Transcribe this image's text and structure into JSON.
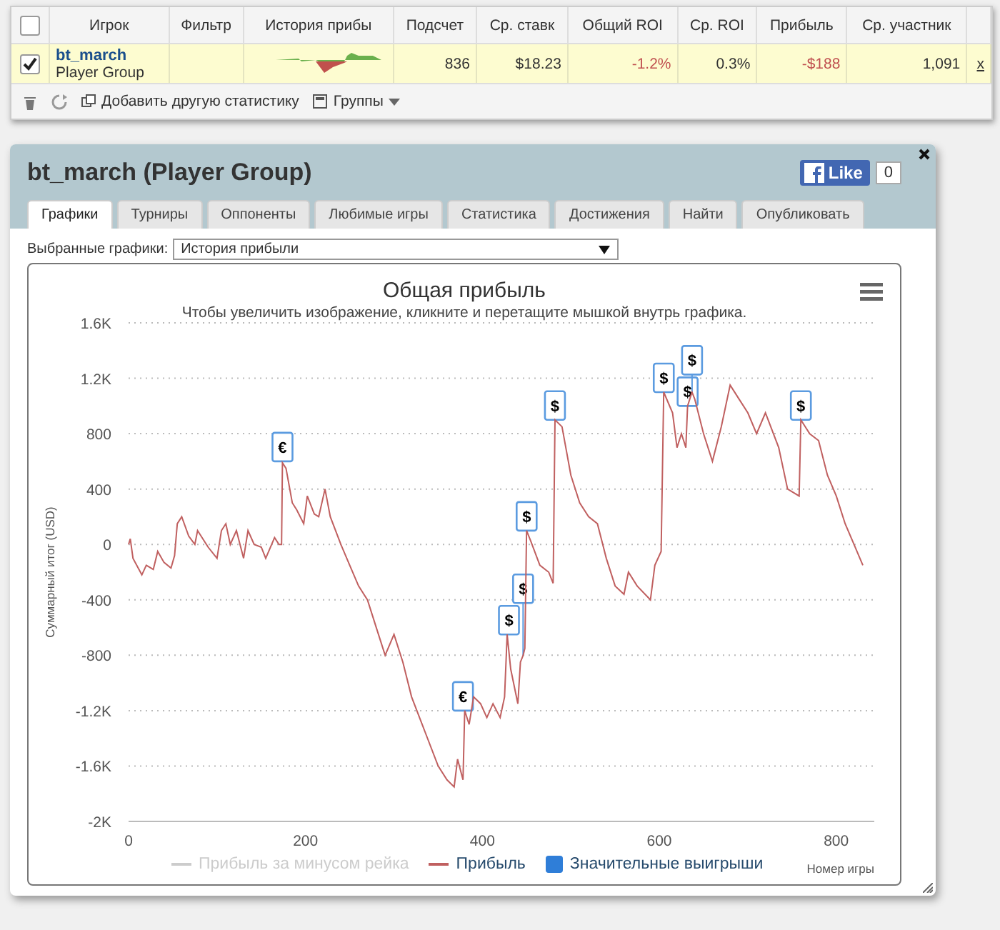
{
  "stats_table": {
    "columns": [
      "Игрок",
      "Фильтр",
      "История прибы",
      "Подсчет",
      "Ср. ставк",
      "Общий ROI",
      "Ср. ROI",
      "Прибыль",
      "Ср. участник"
    ],
    "select_all_checked": false,
    "rows": [
      {
        "checked": true,
        "cells": [
          {
            "kind": "player",
            "text": "bt_march",
            "sub": "Player Group"
          },
          {
            "kind": "text",
            "text": ""
          },
          {
            "kind": "sparkline"
          },
          {
            "kind": "text",
            "text": "836",
            "negative": false
          },
          {
            "kind": "text",
            "text": "$18.23",
            "negative": false
          },
          {
            "kind": "text",
            "text": "-1.2%",
            "negative": true
          },
          {
            "kind": "text",
            "text": "0.3%",
            "negative": false
          },
          {
            "kind": "text",
            "text": "-$188",
            "negative": true
          },
          {
            "kind": "text",
            "text": "1,091",
            "negative": false
          }
        ],
        "remove": "x"
      }
    ],
    "toolbar": {
      "add_stat": "Добавить другую статистику",
      "groups": "Группы"
    }
  },
  "dialog": {
    "title": "bt_march (Player Group)",
    "like": {
      "label": "Like",
      "count": "0"
    },
    "tabs": [
      {
        "label": "Графики",
        "selected": true
      },
      {
        "label": "Турниры",
        "selected": false
      },
      {
        "label": "Оппоненты",
        "selected": false
      },
      {
        "label": "Любимые игры",
        "selected": false
      },
      {
        "label": "Статистика",
        "selected": false
      },
      {
        "label": "Достижения",
        "selected": false
      },
      {
        "label": "Найти",
        "selected": false
      },
      {
        "label": "Опубликовать",
        "selected": false
      }
    ],
    "chart_select": {
      "label": "Выбранные графики:",
      "value": "История прибыли"
    },
    "chart": {
      "chart_data": {
        "type": "line",
        "title": "Общая прибыль",
        "subtitle": "Чтобы увеличить изображение, кликните и перетащите мышкой внутрь графика.",
        "xlabel": "Номер игры",
        "ylabel": "Суммарный итог (USD)",
        "grid": true,
        "xlim": [
          0,
          843
        ],
        "ylim": [
          -2000,
          1600
        ],
        "xticks": [
          0,
          200,
          400,
          600,
          800
        ],
        "yticks": [
          {
            "value": -2000,
            "label": "-2K"
          },
          {
            "value": -1600,
            "label": "-1.6K"
          },
          {
            "value": -1200,
            "label": "-1.2K"
          },
          {
            "value": -800,
            "label": "-800"
          },
          {
            "value": -400,
            "label": "-400"
          },
          {
            "value": 0,
            "label": "0"
          },
          {
            "value": 400,
            "label": "400"
          },
          {
            "value": 800,
            "label": "800"
          },
          {
            "value": 1200,
            "label": "1.2K"
          },
          {
            "value": 1600,
            "label": "1.6K"
          }
        ],
        "x": [
          0,
          2,
          5,
          15,
          20,
          28,
          33,
          40,
          48,
          52,
          55,
          60,
          68,
          75,
          78,
          90,
          100,
          105,
          110,
          115,
          122,
          130,
          135,
          142,
          150,
          155,
          165,
          170,
          173,
          174,
          178,
          185,
          190,
          198,
          202,
          210,
          215,
          222,
          228,
          240,
          250,
          260,
          270,
          280,
          290,
          300,
          310,
          320,
          335,
          350,
          360,
          368,
          372,
          378,
          380,
          385,
          390,
          398,
          405,
          412,
          420,
          425,
          428,
          432,
          440,
          443,
          446,
          448,
          450,
          455,
          465,
          475,
          480,
          482,
          490,
          500,
          510,
          520,
          530,
          540,
          550,
          560,
          565,
          575,
          590,
          595,
          602,
          605,
          615,
          620,
          625,
          630,
          632,
          637,
          640,
          650,
          660,
          670,
          680,
          690,
          700,
          710,
          720,
          735,
          745,
          758,
          760,
          770,
          780,
          790,
          800,
          810,
          820,
          830
        ],
        "series": [
          {
            "name": "Прибыль",
            "color": "#c06060",
            "values": [
              0,
              40,
              -100,
              -220,
              -150,
              -180,
              -50,
              -130,
              -170,
              -80,
              150,
              200,
              60,
              0,
              100,
              -20,
              -100,
              100,
              150,
              0,
              100,
              -100,
              100,
              0,
              -20,
              -100,
              50,
              0,
              0,
              590,
              550,
              300,
              250,
              150,
              350,
              220,
              200,
              400,
              200,
              0,
              -150,
              -300,
              -400,
              -600,
              -800,
              -650,
              -850,
              -1100,
              -1350,
              -1600,
              -1700,
              -1750,
              -1550,
              -1700,
              -1200,
              -1300,
              -1100,
              -1150,
              -1250,
              -1150,
              -1250,
              -1100,
              -650,
              -900,
              -1150,
              -850,
              -800,
              -750,
              100,
              20,
              -150,
              -200,
              -280,
              900,
              850,
              500,
              300,
              200,
              150,
              -100,
              -300,
              -360,
              -200,
              -300,
              -400,
              -150,
              -50,
              1100,
              950,
              700,
              800,
              700,
              1000,
              1100,
              1050,
              800,
              600,
              850,
              1150,
              1050,
              950,
              800,
              950,
              700,
              400,
              350,
              900,
              800,
              750,
              500,
              350,
              150,
              0,
              -150
            ]
          }
        ],
        "annotations": [
          {
            "x": 174,
            "y": 600,
            "text": "€"
          },
          {
            "x": 378,
            "y": -1200,
            "text": "€"
          },
          {
            "x": 430,
            "y": -650,
            "text": "$"
          },
          {
            "x": 446,
            "y": -800,
            "text": "$"
          },
          {
            "x": 450,
            "y": 100,
            "text": "$"
          },
          {
            "x": 482,
            "y": 900,
            "text": "$"
          },
          {
            "x": 605,
            "y": 1100,
            "text": "$"
          },
          {
            "x": 632,
            "y": 1000,
            "text": "$"
          },
          {
            "x": 637,
            "y": 1100,
            "text": "$"
          },
          {
            "x": 760,
            "y": 900,
            "text": "$"
          }
        ]
      },
      "legend": [
        {
          "label": "Прибыль за минусом рейка",
          "kind": "line",
          "color": "#cccccc",
          "disabled": true
        },
        {
          "kind": "series",
          "disabled": false
        },
        {
          "label": "Значительные выигрыши",
          "kind": "swatch",
          "color": "#2f7ed8",
          "disabled": false
        }
      ]
    }
  }
}
